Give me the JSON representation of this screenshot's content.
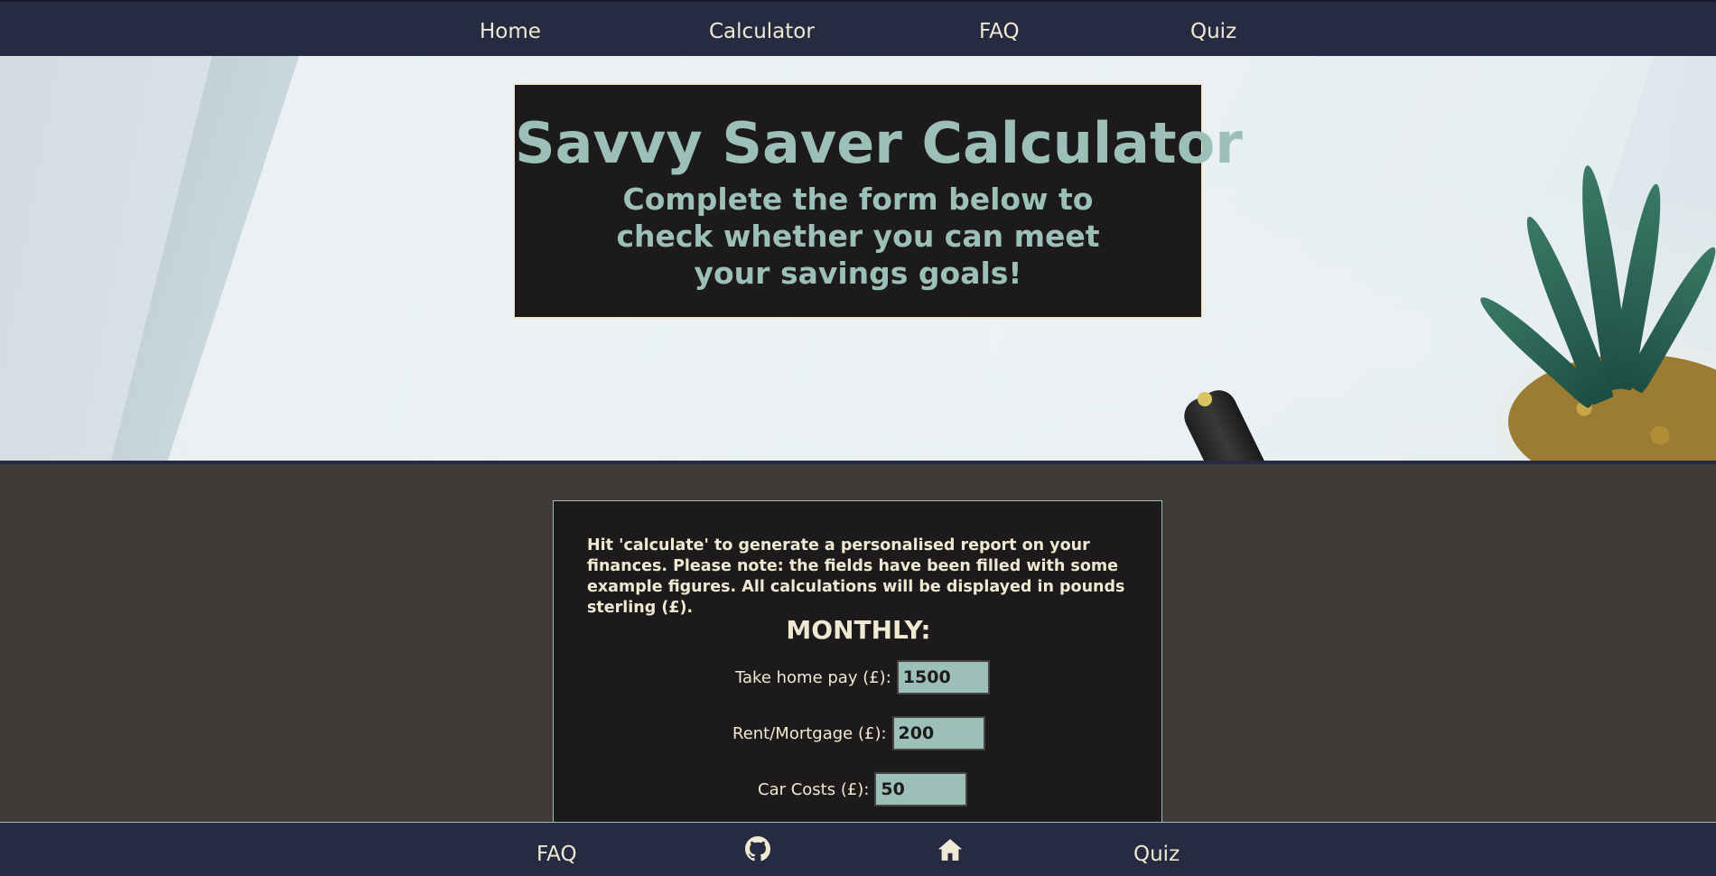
{
  "nav": {
    "home": "Home",
    "calculator": "Calculator",
    "faq": "FAQ",
    "quiz": "Quiz"
  },
  "hero": {
    "title": "Savvy Saver Calculator",
    "subtitle": "Complete the form below to check whether you can meet your savings goals!"
  },
  "form": {
    "intro": "Hit 'calculate' to generate a personalised report on your finances. Please note: the fields have been filled with some example figures. All calculations will be displayed in pounds sterling (£).",
    "section_heading": "MONTHLY:",
    "fields": [
      {
        "label": "Take home pay (£):",
        "value": "1500"
      },
      {
        "label": "Rent/Mortgage (£):",
        "value": "200"
      },
      {
        "label": "Car Costs (£):",
        "value": "50"
      }
    ]
  },
  "footer": {
    "faq": "FAQ",
    "github_icon": "github-icon",
    "home_icon": "home-icon",
    "quiz": "Quiz"
  },
  "colors": {
    "nav_bg": "#272b41",
    "text_cream": "#efe9d3",
    "accent_teal": "#9cbfb7",
    "card_bg": "#1c1a1b",
    "page_bg": "#403b38"
  }
}
